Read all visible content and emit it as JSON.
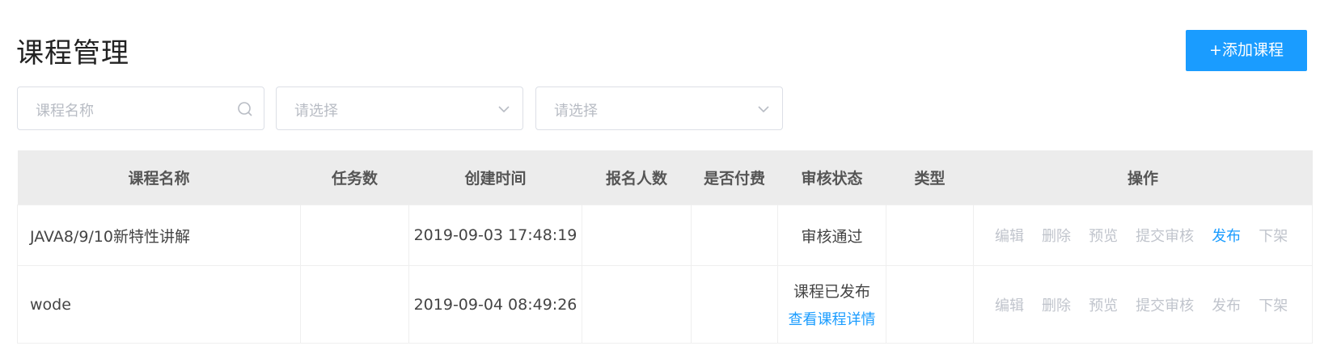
{
  "page": {
    "title": "课程管理",
    "add_button": "+添加课程"
  },
  "filters": {
    "name_placeholder": "课程名称",
    "select1_placeholder": "请选择",
    "select2_placeholder": "请选择"
  },
  "table": {
    "headers": [
      "课程名称",
      "任务数",
      "创建时间",
      "报名人数",
      "是否付费",
      "审核状态",
      "类型",
      "操作"
    ],
    "rows": [
      {
        "name": "JAVA8/9/10新特性讲解",
        "tasks": "",
        "created": "2019-09-03 17:48:19",
        "enrolled": "",
        "paid": "",
        "status": "审核通过",
        "status_link": "",
        "type": "",
        "ops": [
          "编辑",
          "删除",
          "预览",
          "提交审核",
          "发布",
          "下架"
        ],
        "active_op": "发布"
      },
      {
        "name": "wode",
        "tasks": "",
        "created": "2019-09-04 08:49:26",
        "enrolled": "",
        "paid": "",
        "status": "课程已发布",
        "status_link": "查看课程详情",
        "type": "",
        "ops": [
          "编辑",
          "删除",
          "预览",
          "提交审核",
          "发布",
          "下架"
        ],
        "active_op": ""
      }
    ]
  },
  "colors": {
    "accent": "#1a9cff",
    "disabled": "#c0c4cc",
    "header_bg": "#ececec"
  }
}
